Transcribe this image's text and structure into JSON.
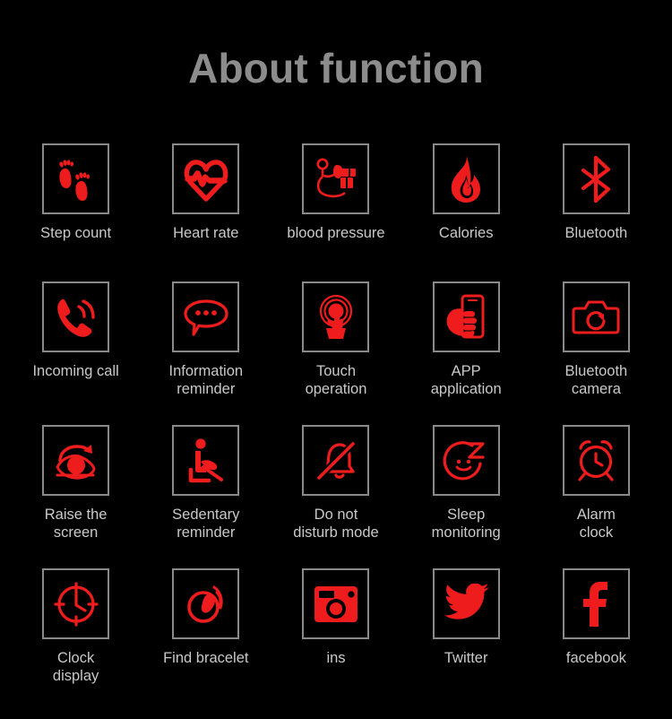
{
  "page": {
    "title": "About function",
    "background_color": "#000000",
    "title_color": "#8c8c8c",
    "label_color": "#c9c9c9",
    "icon_color": "#ee1c1c",
    "box_border_color": "#8a8a8a"
  },
  "grid": {
    "columns": 5,
    "rows": 4,
    "items": [
      {
        "label": "Step count",
        "icon": "footprints-icon"
      },
      {
        "label": "Heart rate",
        "icon": "heart-pulse-icon"
      },
      {
        "label": "blood pressure",
        "icon": "blood-pressure-monitor-icon"
      },
      {
        "label": "Calories",
        "icon": "flame-icon"
      },
      {
        "label": "Bluetooth",
        "icon": "bluetooth-icon"
      },
      {
        "label": "Incoming call",
        "icon": "ringing-phone-icon"
      },
      {
        "label": "Information\nreminder",
        "icon": "speech-bubble-icon"
      },
      {
        "label": "Touch\noperation",
        "icon": "touch-tap-icon"
      },
      {
        "label": "APP\napplication",
        "icon": "hand-holding-phone-icon"
      },
      {
        "label": "Bluetooth\ncamera",
        "icon": "camera-icon"
      },
      {
        "label": "Raise the\nscreen",
        "icon": "eye-rotate-icon"
      },
      {
        "label": "Sedentary\nreminder",
        "icon": "sitting-person-icon"
      },
      {
        "label": "Do not\ndisturb mode",
        "icon": "bell-slash-icon"
      },
      {
        "label": "Sleep\nmonitoring",
        "icon": "sleeping-face-icon"
      },
      {
        "label": "Alarm\nclock",
        "icon": "alarm-clock-icon"
      },
      {
        "label": "Clock\ndisplay",
        "icon": "clock-icon"
      },
      {
        "label": "Find bracelet",
        "icon": "find-bracelet-icon"
      },
      {
        "label": "ins",
        "icon": "instagram-icon"
      },
      {
        "label": "Twitter",
        "icon": "twitter-bird-icon"
      },
      {
        "label": "facebook",
        "icon": "facebook-f-icon"
      }
    ]
  }
}
